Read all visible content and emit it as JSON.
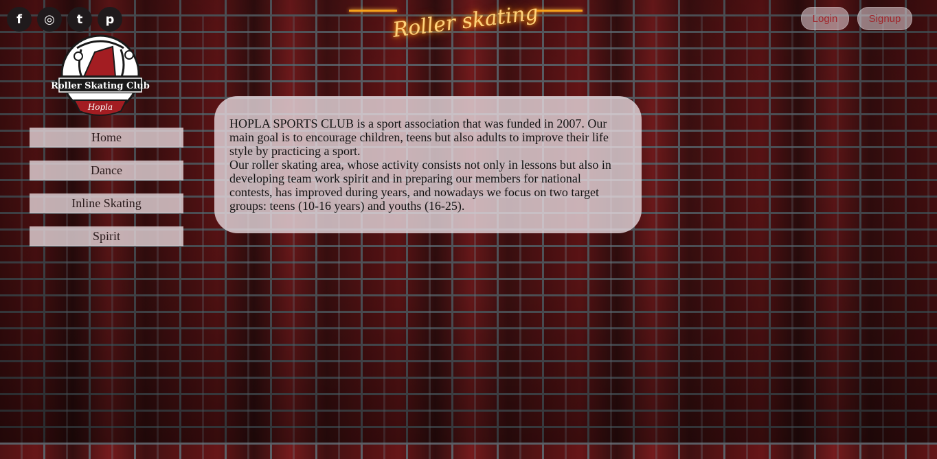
{
  "social": {
    "icons": [
      {
        "name": "facebook-icon",
        "glyph": "f"
      },
      {
        "name": "instagram-icon",
        "glyph": "◎"
      },
      {
        "name": "twitter-icon",
        "glyph": "t"
      },
      {
        "name": "pinterest-icon",
        "glyph": "p"
      }
    ]
  },
  "header": {
    "neon_title": "Roller skating"
  },
  "auth": {
    "login_label": "Login",
    "signup_label": "Signup"
  },
  "logo": {
    "banner_text": "Roller Skating Club",
    "ribbon_text": "Hopla"
  },
  "nav": {
    "items": [
      {
        "label": "Home"
      },
      {
        "label": "Dance"
      },
      {
        "label": "Inline Skating"
      },
      {
        "label": "Spirit"
      }
    ]
  },
  "content": {
    "paragraph1": "HOPLA SPORTS CLUB is a sport association that was funded in 2007. Our main goal is to encourage children, teens but also adults to improve their life style by practicing a sport.",
    "paragraph2": "Our roller skating area, whose activity consists not only in lessons but also in developing team work spirit and in preparing our members for national contests, has improved during years, and nowadays we focus on two target groups: teens (10-16 years) and youths (16-25)."
  },
  "colors": {
    "accent_red": "#a0262b",
    "neon_orange": "#f6a21b",
    "panel_bg": "#e6dade"
  }
}
